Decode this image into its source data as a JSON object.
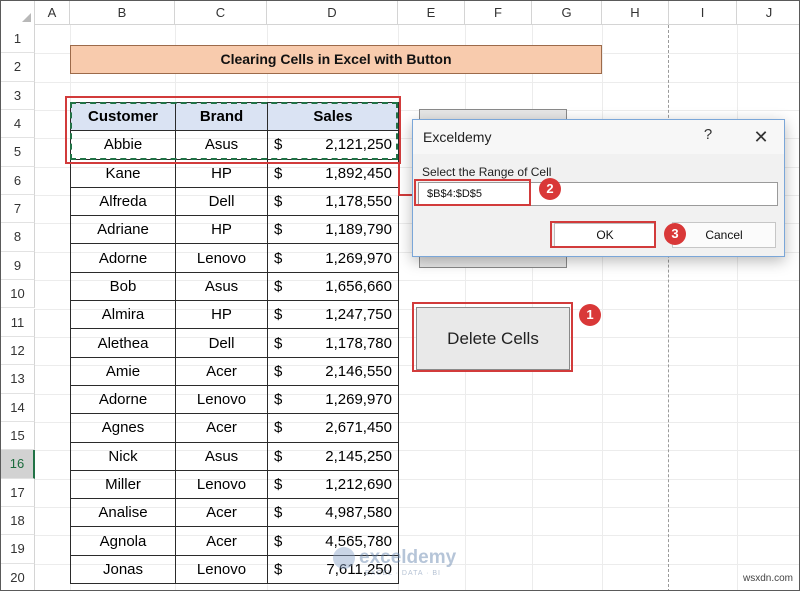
{
  "columns": [
    "A",
    "B",
    "C",
    "D",
    "E",
    "F",
    "G",
    "H",
    "I",
    "J"
  ],
  "rows": [
    "1",
    "2",
    "3",
    "4",
    "5",
    "6",
    "7",
    "8",
    "9",
    "10",
    "11",
    "12",
    "13",
    "14",
    "15",
    "16",
    "17",
    "18",
    "19",
    "20"
  ],
  "active_row": "16",
  "title": "Clearing Cells in Excel with Button",
  "table": {
    "headers": [
      "Customer",
      "Brand",
      "Sales"
    ],
    "currency": "$",
    "rows": [
      {
        "customer": "Abbie",
        "brand": "Asus",
        "sales": "2,121,250"
      },
      {
        "customer": "Kane",
        "brand": "HP",
        "sales": "1,892,450"
      },
      {
        "customer": "Alfreda",
        "brand": "Dell",
        "sales": "1,178,550"
      },
      {
        "customer": "Adriane",
        "brand": "HP",
        "sales": "1,189,790"
      },
      {
        "customer": "Adorne",
        "brand": "Lenovo",
        "sales": "1,269,970"
      },
      {
        "customer": "Bob",
        "brand": "Asus",
        "sales": "1,656,660"
      },
      {
        "customer": "Almira",
        "brand": "HP",
        "sales": "1,247,750"
      },
      {
        "customer": "Alethea",
        "brand": "Dell",
        "sales": "1,178,780"
      },
      {
        "customer": "Amie",
        "brand": "Acer",
        "sales": "2,146,550"
      },
      {
        "customer": "Adorne",
        "brand": "Lenovo",
        "sales": "1,269,970"
      },
      {
        "customer": "Agnes",
        "brand": "Acer",
        "sales": "2,671,450"
      },
      {
        "customer": "Nick",
        "brand": "Asus",
        "sales": "2,145,250"
      },
      {
        "customer": "Miller",
        "brand": "Lenovo",
        "sales": "1,212,690"
      },
      {
        "customer": "Analise",
        "brand": "Acer",
        "sales": "4,987,580"
      },
      {
        "customer": "Agnola",
        "brand": "Acer",
        "sales": "4,565,780"
      },
      {
        "customer": "Jonas",
        "brand": "Lenovo",
        "sales": "7,611,250"
      }
    ]
  },
  "delete_button": {
    "label": "Delete Cells"
  },
  "dialog": {
    "title": "Exceldemy",
    "help": "?",
    "close": "✕",
    "prompt": "Select the Range of Cell",
    "input_value": "$B$4:$D$5",
    "ok_label": "OK",
    "cancel_label": "Cancel"
  },
  "callouts": [
    "1",
    "2",
    "3"
  ],
  "watermark": {
    "name": "exceldemy",
    "tagline": "EXCEL · DATA · BI"
  },
  "site_tag": "wsxdn.com",
  "colors": {
    "title_fill": "#f8cbad",
    "header_fill": "#dae3f3",
    "highlight": "#d23b3b",
    "selection": "#217346"
  }
}
